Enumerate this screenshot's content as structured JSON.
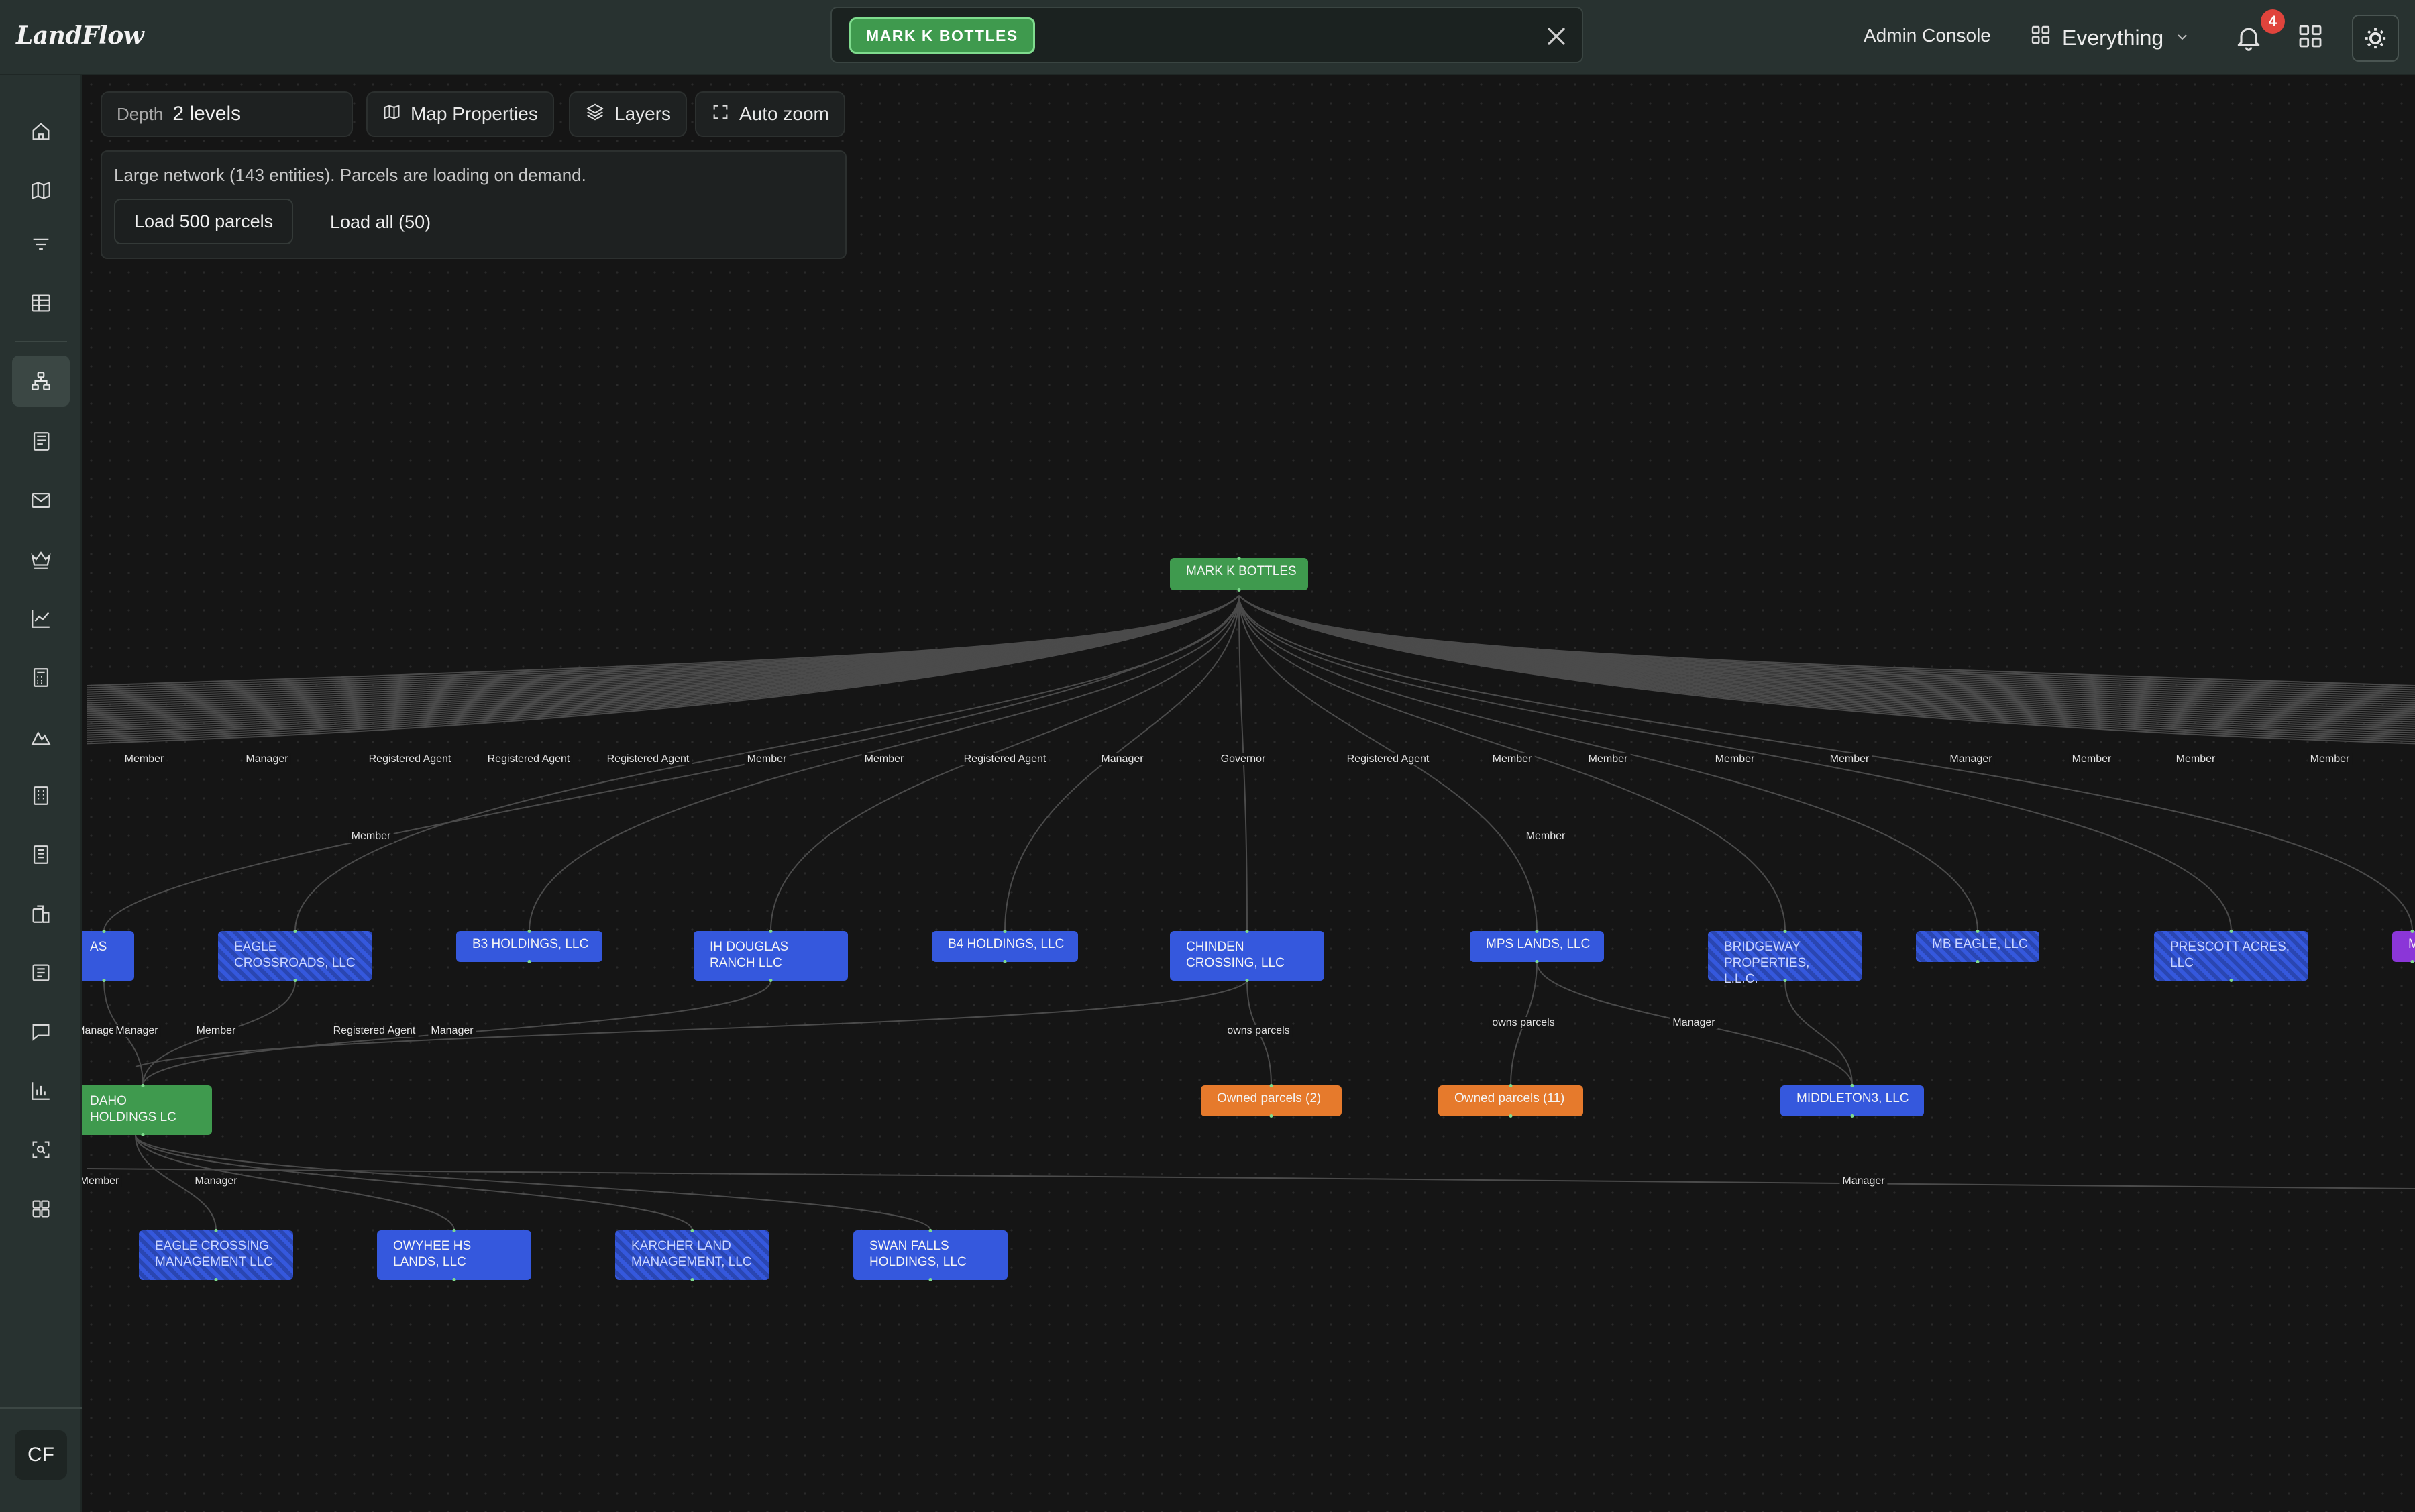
{
  "app": {
    "logo": "LandFlow"
  },
  "header": {
    "search_chip": "MARK K BOTTLES",
    "admin_console": "Admin Console",
    "workspace": "Everything",
    "notifications_count": "4"
  },
  "sidebar": {
    "items": [
      {
        "icon": "home-icon"
      },
      {
        "icon": "map-icon"
      },
      {
        "icon": "filter-icon"
      },
      {
        "icon": "table-icon"
      },
      {
        "icon": "network-icon",
        "active": true
      },
      {
        "icon": "newspaper-icon"
      },
      {
        "icon": "mail-icon"
      },
      {
        "icon": "crown-icon"
      },
      {
        "icon": "line-chart-icon"
      },
      {
        "icon": "calculator-icon"
      },
      {
        "icon": "mountain-icon"
      },
      {
        "icon": "building-icon"
      },
      {
        "icon": "building-2-icon"
      },
      {
        "icon": "buildings-icon"
      },
      {
        "icon": "document-icon"
      },
      {
        "icon": "chat-icon"
      },
      {
        "icon": "bar-chart-icon"
      },
      {
        "icon": "scan-search-icon"
      },
      {
        "icon": "grid-icon"
      }
    ],
    "avatar": "CF"
  },
  "toolbar": {
    "depth_label": "Depth",
    "depth_value": "2 levels",
    "map_properties": "Map Properties",
    "layers": "Layers",
    "auto_zoom": "Auto zoom"
  },
  "notice": {
    "text": "Large network (143 entities). Parcels are loading on demand.",
    "load_500": "Load 500 parcels",
    "load_all": "Load all (50)"
  },
  "graph": {
    "root": "MARK K BOTTLES",
    "nodes_level1": [
      {
        "id": "n_as",
        "label": "AS"
      },
      {
        "id": "n_eagle",
        "label": "EAGLE CROSSROADS, LLC"
      },
      {
        "id": "n_b3",
        "label": "B3 HOLDINGS, LLC"
      },
      {
        "id": "n_ihd",
        "label": "IH DOUGLAS RANCH LLC"
      },
      {
        "id": "n_b4",
        "label": "B4 HOLDINGS, LLC"
      },
      {
        "id": "n_chinden",
        "label": "CHINDEN CROSSING, LLC"
      },
      {
        "id": "n_mps",
        "label": "MPS LANDS, LLC"
      },
      {
        "id": "n_bridgeway",
        "label": "BRIDGEWAY PROPERTIES, L.L.C."
      },
      {
        "id": "n_mbeagle",
        "label": "MB EAGLE, LLC"
      },
      {
        "id": "n_prescott",
        "label": "PRESCOTT ACRES, LLC"
      },
      {
        "id": "n_m",
        "label": "M"
      }
    ],
    "nodes_level2": [
      {
        "id": "n_idaho",
        "label": "DAHO HOLDINGS LC"
      },
      {
        "id": "n_owned2",
        "label": "Owned parcels (2)"
      },
      {
        "id": "n_owned11",
        "label": "Owned parcels (11)"
      },
      {
        "id": "n_middleton",
        "label": "MIDDLETON3, LLC"
      }
    ],
    "nodes_level3": [
      {
        "id": "n_eaglemgmt",
        "label": "EAGLE CROSSING MANAGEMENT LLC"
      },
      {
        "id": "n_owyhee",
        "label": "OWYHEE HS LANDS, LLC"
      },
      {
        "id": "n_karcher",
        "label": "KARCHER LAND MANAGEMENT, LLC"
      },
      {
        "id": "n_swan",
        "label": "SWAN FALLS HOLDINGS, LLC"
      }
    ],
    "edge_labels_row1": [
      "Member",
      "Manager",
      "Registered Agent",
      "Registered Agent",
      "Registered Agent",
      "Member",
      "Member",
      "Registered Agent",
      "Manager",
      "Governor",
      "Registered Agent",
      "Member",
      "Member",
      "Member",
      "Member",
      "Manager",
      "Member",
      "Member",
      "Member"
    ],
    "edge_labels_row2": [
      "Member",
      "Member"
    ],
    "edge_labels_row3": [
      "Manage",
      "Manager",
      "Member",
      "Registered Agent",
      "Manager",
      "owns parcels",
      "owns parcels",
      "Manager"
    ],
    "edge_labels_row4": [
      "Member",
      "Manager",
      "Manager"
    ]
  }
}
